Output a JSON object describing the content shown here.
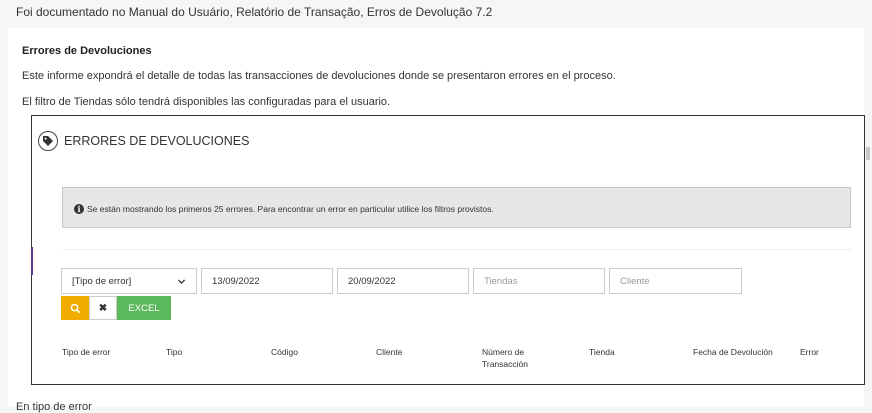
{
  "doc": {
    "reference": "Foi documentado no Manual do Usuário, Relatório de Transação, Erros de Devolução 7.2",
    "section_title": "Errores de Devoluciones",
    "paragraph1": "Este informe expondrá el detalle de todas las transacciones de devoluciones donde se presentaron errores en el proceso.",
    "paragraph2": "El filtro de Tiendas sólo tendrá disponibles las configuradas para el usuario.",
    "trailing_text": "En tipo de error"
  },
  "panel": {
    "title": "ERRORES DE DEVOLUCIONES",
    "header_icon": "tag-icon"
  },
  "alert": {
    "icon": "info-icon",
    "text": "Se están mostrando los primeros 25 errores. Para encontrar un error en particular utilice los filtros provistos."
  },
  "filters": {
    "error_type": "[Tipo de error]",
    "date_from": "13/09/2022",
    "date_to": "20/09/2022",
    "stores_placeholder": "Tiendas",
    "client_placeholder": "Cliente"
  },
  "buttons": {
    "search_icon": "search-icon",
    "clear_label": "✖",
    "excel_label": "EXCEL"
  },
  "table": {
    "columns": [
      "Tipo de error",
      "Tipo",
      "Código",
      "Cliente",
      "Número de",
      "Tienda",
      "Fecha de Devolución",
      "Error"
    ],
    "column4_line2": "Transacción"
  },
  "colors": {
    "search_button": "#f0ad00",
    "excel_button": "#5cb85c",
    "alert_bg": "#e6e6e6",
    "accent": "#5b3a8c"
  }
}
